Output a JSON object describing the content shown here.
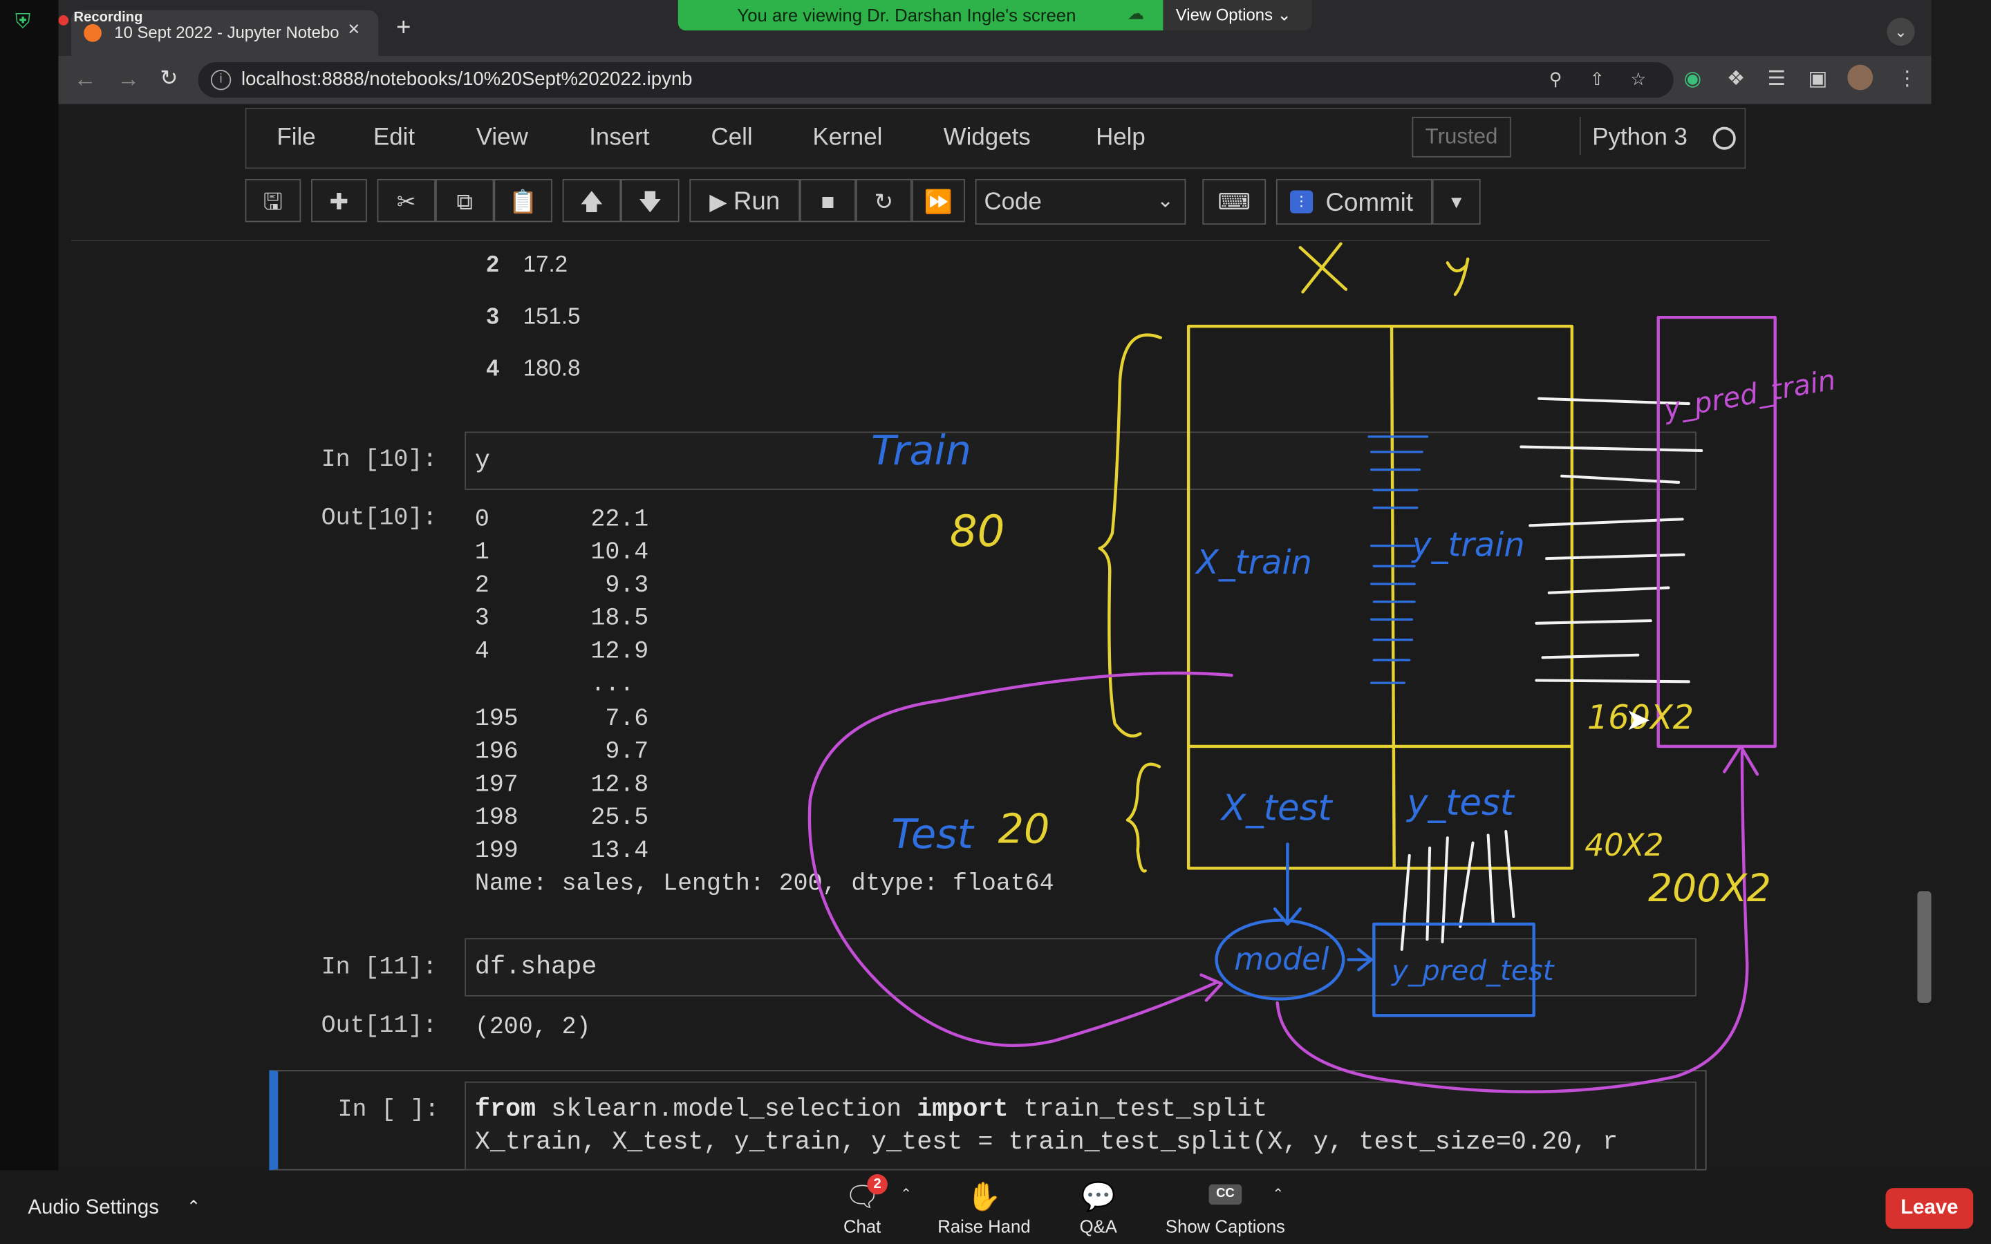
{
  "recording": {
    "label": "Recording"
  },
  "browser": {
    "tab_title": "10 Sept 2022 - Jupyter Notebo",
    "url": "localhost:8888/notebooks/10%20Sept%202022.ipynb"
  },
  "share_banner": {
    "text": "You are viewing Dr. Darshan Ingle's screen",
    "view_options": "View Options"
  },
  "jupyter": {
    "menu": [
      "File",
      "Edit",
      "View",
      "Insert",
      "Cell",
      "Kernel",
      "Widgets",
      "Help"
    ],
    "trusted": "Trusted",
    "kernel": "Python 3",
    "toolbar": {
      "run_label": "Run",
      "cell_type": "Code",
      "commit_label": "Commit"
    }
  },
  "notebook": {
    "df_tail_rows": [
      {
        "index": "2",
        "value": "17.2"
      },
      {
        "index": "3",
        "value": "151.5"
      },
      {
        "index": "4",
        "value": "180.8"
      }
    ],
    "cell10": {
      "in_prompt": "In [10]:",
      "code": "y",
      "out_prompt": "Out[10]:",
      "output_lines": [
        "0       22.1",
        "1       10.4",
        "2        9.3",
        "3       18.5",
        "4       12.9",
        "        ...",
        "195      7.6",
        "196      9.7",
        "197     12.8",
        "198     25.5",
        "199     13.4",
        "Name: sales, Length: 200, dtype: float64"
      ]
    },
    "cell11": {
      "in_prompt": "In [11]:",
      "code": "df.shape",
      "out_prompt": "Out[11]:",
      "output": "(200, 2)"
    },
    "cell_next": {
      "in_prompt": "In [ ]:",
      "line1_kw1": "from",
      "line1_mod": " sklearn.model_selection ",
      "line1_kw2": "import",
      "line1_rest": " train_test_split",
      "line2": "X_train, X_test, y_train, y_test = train_test_split(X, y, test_size=0.20, r"
    }
  },
  "annotations": {
    "X": "X",
    "y": "y",
    "train": "Train",
    "train_pct": "80",
    "test": "Test",
    "test_pct": "20",
    "x_train": "X_train",
    "y_train": "y_train",
    "y_pred_train": "y_pred_train",
    "x_test": "X_test",
    "y_test": "y_test",
    "model": "model",
    "y_pred_test": "y_pred_test",
    "shape_train": "160X2",
    "shape_test": "40X2",
    "shape_total": "200X2"
  },
  "zoom_controls": {
    "audio_settings": "Audio Settings",
    "chat": "Chat",
    "chat_badge": "2",
    "raise_hand": "Raise Hand",
    "qa": "Q&A",
    "show_captions": "Show Captions",
    "leave": "Leave"
  },
  "colors": {
    "annotation_yellow": "#e6d232",
    "annotation_blue": "#2f6fe0",
    "annotation_magenta": "#c24fd6",
    "leave_red": "#d7322e",
    "share_green": "#2db34a"
  }
}
